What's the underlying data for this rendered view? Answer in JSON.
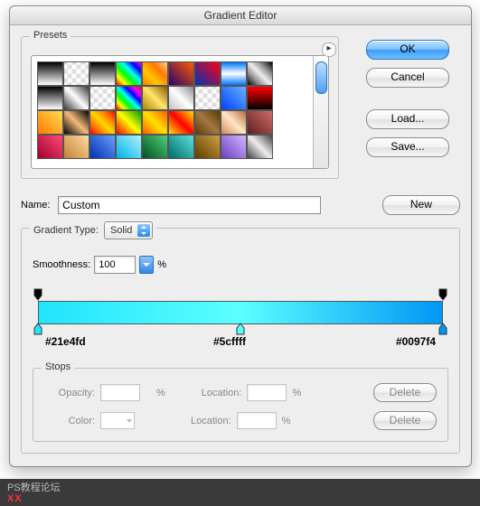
{
  "window": {
    "title": "Gradient Editor"
  },
  "buttons": {
    "ok": "OK",
    "cancel": "Cancel",
    "load": "Load...",
    "save": "Save...",
    "new": "New",
    "delete": "Delete"
  },
  "presets": {
    "legend": "Presets",
    "swatches": [
      "linear-gradient(#000,#fff)",
      "repeating-conic-gradient(#fff 0 25%, #ddd 0 50%) 50%/10px 10px",
      "linear-gradient(#000,#fff)",
      "linear-gradient(45deg,#ff0000,#ffff00,#00ff00,#00ffff,#0000ff,#ff00ff)",
      "linear-gradient(45deg,#ff7a00,#ffc800,#ff7a00,#ffd38a)",
      "linear-gradient(45deg,#2b006e,#ff5a00)",
      "linear-gradient(45deg,#0033b0,#ff0015)",
      "linear-gradient(#0073ff,#fff,#0073ff)",
      "linear-gradient(45deg,#000,#888,#eee,#888,#000)",
      "linear-gradient(#000,#fff)",
      "linear-gradient(45deg,#3a3a3a,#fff,#3a3a3a)",
      "repeating-conic-gradient(#fff 0 25%, #ddd 0 50%) 50%/10px 10px",
      "linear-gradient(45deg,#ff0000,#ffff00,#00ff00,#00ffff,#0000ff,#ff00ff,#ff0000)",
      "linear-gradient(45deg,#b08300,#ffe56b,#8a5a00)",
      "linear-gradient(45deg,#c0c0c0,#ffffff,#8a8a8a)",
      "repeating-conic-gradient(#fff 0 25%, #ddd 0 50%) 50%/10px 10px",
      "linear-gradient(45deg,#0040ff,#66b3ff)",
      "linear-gradient(#ff0000,#000000)",
      "linear-gradient(45deg,#ff7a00,#ffdd55)",
      "linear-gradient(45deg,#000,#f5ba7a,#000)",
      "linear-gradient(45deg,#ff0000,#ff7a00,#ffd700,#ff7a00,#ff0000)",
      "linear-gradient(45deg,#ff0000,#ffff00,#00a000)",
      "linear-gradient(45deg,#ff5a00,#ffe200,#ff5a00)",
      "linear-gradient(45deg,#ffe200,#ff0000,#ffe200)",
      "linear-gradient(45deg,#5c3c00,#a37842,#5c3c00)",
      "linear-gradient(45deg,#d28b5a,#ffe7c8,#b56a3e)",
      "linear-gradient(45deg,#5c1f1f,#d26a6a)",
      "linear-gradient(45deg,#a0002a,#ff4b7a)",
      "linear-gradient(45deg,#c58036,#ffdca0)",
      "linear-gradient(45deg,#002fb0,#6aa0ff)",
      "linear-gradient(45deg,#00b0e5,#b0f3ff)",
      "linear-gradient(45deg,#005022,#4fd07a)",
      "linear-gradient(45deg,#006c68,#5de2db)",
      "linear-gradient(45deg,#5a3d00,#d2a041)",
      "linear-gradient(45deg,#6a3fc2,#d2b8ff)",
      "linear-gradient(45deg,#444,#eee,#444)"
    ]
  },
  "name": {
    "label": "Name:",
    "value": "Custom"
  },
  "gradientType": {
    "legend": "Gradient Type:",
    "value": "Solid",
    "smoothness_label": "Smoothness:",
    "smoothness_value": "100",
    "percent": "%"
  },
  "gradient": {
    "css": "linear-gradient(90deg,#21e4fd 0%, #5cffff 50%, #0097f4 100%)",
    "stops_hex": [
      "#21e4fd",
      "#5cffff",
      "#0097f4"
    ],
    "opacity_stops_pct": [
      0,
      100
    ],
    "color_stops_pct": [
      0,
      50,
      100
    ]
  },
  "stops": {
    "legend": "Stops",
    "opacity_label": "Opacity:",
    "color_label": "Color:",
    "location_label": "Location:",
    "percent": "%"
  },
  "footer": {
    "line1": "PS教程论坛",
    "xx": "XX"
  }
}
